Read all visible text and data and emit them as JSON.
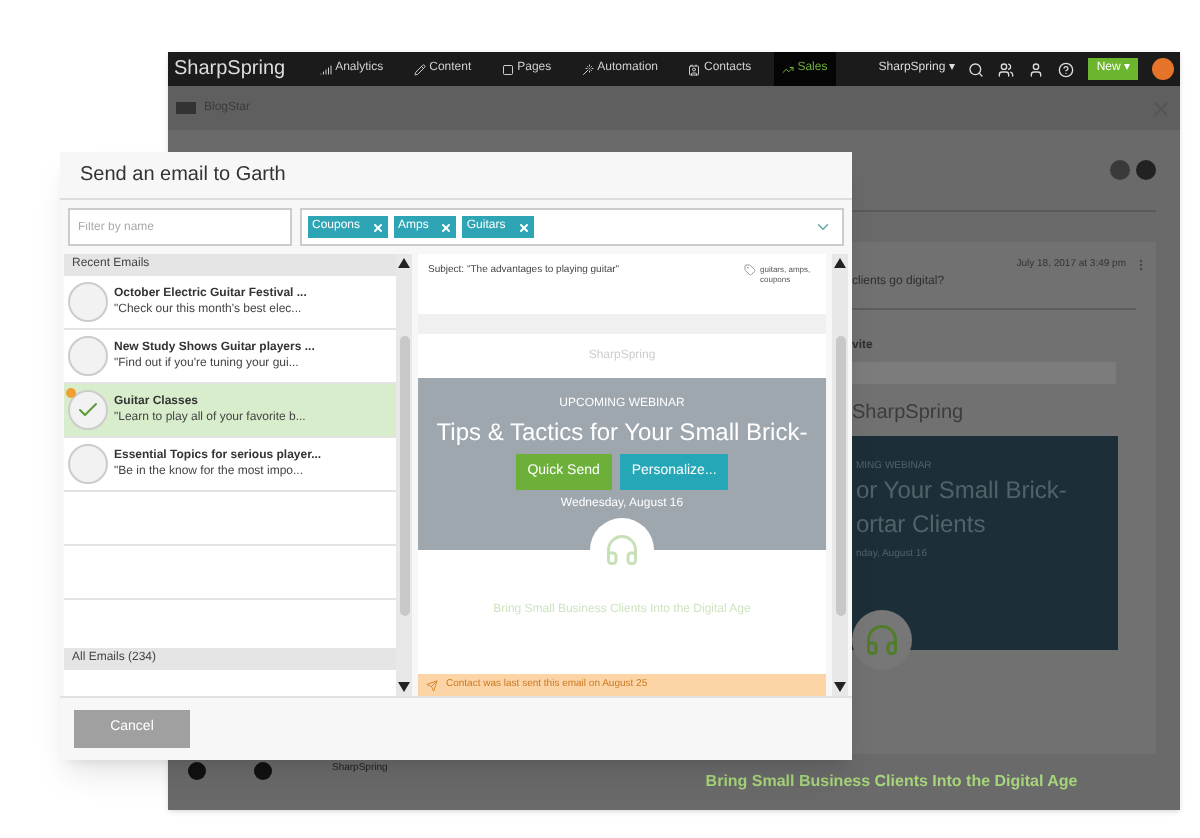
{
  "app": {
    "logo": "SharpSpring",
    "nav": [
      {
        "label": "Analytics",
        "selected": false
      },
      {
        "label": "Content",
        "selected": false
      },
      {
        "label": "Pages",
        "selected": false
      },
      {
        "label": "Automation",
        "selected": false
      },
      {
        "label": "Contacts",
        "selected": false
      },
      {
        "label": "Sales",
        "selected": true
      }
    ],
    "account": "SharpSpring ▾",
    "new_button": "New ▾",
    "page_title": "BlogStar"
  },
  "background": {
    "date": "July 18, 2017 at 3:49 pm",
    "question": "clients go digital?",
    "section": "vite",
    "brand": "SharpSpring",
    "webinar_label": "MING WEBINAR",
    "headline_lines": [
      "or Your Small Brick-",
      "ortar Clients"
    ],
    "date_line": "nday, August 16",
    "cta": "Bring Small Business Clients Into the Digital Age",
    "footer_name": "SharpSpring"
  },
  "dialog": {
    "title": "Send an email to Garth",
    "filter": {
      "placeholder": "Filter by name"
    },
    "tags": [
      "Coupons",
      "Amps",
      "Guitars"
    ],
    "recent_header": "Recent Emails",
    "emails": [
      {
        "title": "October Electric Guitar Festival ...",
        "snippet": "\"Check our this month's best elec...",
        "selected": false
      },
      {
        "title": "New Study Shows Guitar players ...",
        "snippet": "\"Find out if you're tuning your gui...",
        "selected": false
      },
      {
        "title": "Guitar Classes",
        "snippet": "\"Learn to play all of your favorite b...",
        "selected": true
      },
      {
        "title": "Essential Topics for serious player...",
        "snippet": "\"Be in the know for the most impo...",
        "selected": false
      }
    ],
    "all_header": "All Emails (234)",
    "preview": {
      "subject": "Subject: \"The advantages to playing guitar\"",
      "tags": "guitars, amps, coupons",
      "logo": "SharpSpring",
      "label": "UPCOMING WEBINAR",
      "headline": "Tips & Tactics for Your Small Brick-",
      "date": "Wednesday, August 16",
      "title": "Bring Small Business Clients Into the Digital Age",
      "notice": "Contact was last sent this email on August 25"
    },
    "actions": [
      "Quick Send",
      "Personalize..."
    ],
    "cancel": "Cancel"
  }
}
